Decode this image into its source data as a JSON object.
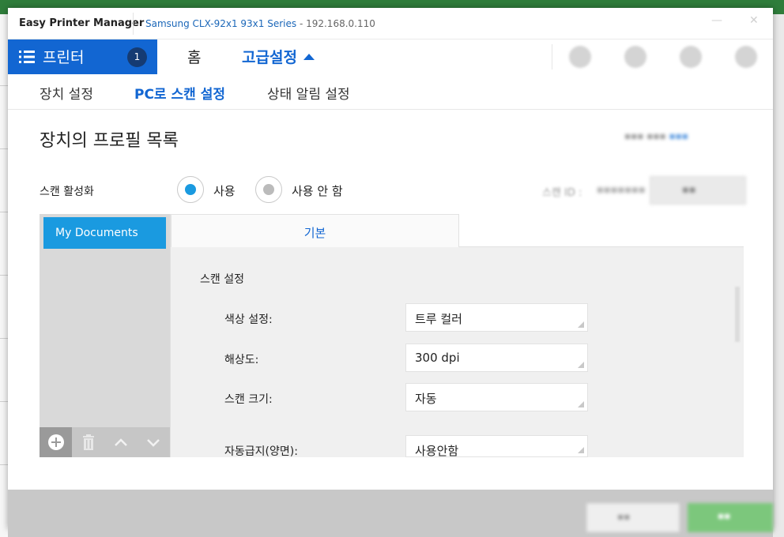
{
  "window": {
    "app_title": "Easy Printer Manager",
    "device_name": "Samsung CLX-92x1 93x1 Series",
    "device_ip": " - 192.168.0.110"
  },
  "nav": {
    "printer_label": "프린터",
    "printer_count": "1",
    "home_label": "홈",
    "advanced_label": "고급설정"
  },
  "subtabs": [
    "장치 설정",
    "PC로 스캔 설정",
    "상태 알림 설정"
  ],
  "content": {
    "heading": "장치의 프로필 목록",
    "scan_enable_label": "스캔 활성화",
    "radio_use": "사용",
    "radio_not_use": "사용 안 함",
    "scan_id_label": "스캔 ID :"
  },
  "profiles": [
    "My Documents"
  ],
  "detail": {
    "tab_basic": "기본",
    "section_title": "스캔 설정",
    "fields": [
      {
        "label": "색상 설정:",
        "value": "트루 컬러"
      },
      {
        "label": "해상도:",
        "value": "300 dpi"
      },
      {
        "label": "스캔 크기:",
        "value": "자동"
      },
      {
        "label": "자동급지(양면):",
        "value": "사용안함"
      }
    ]
  },
  "colors": {
    "accent": "#1266d2",
    "selection": "#1a9ae0",
    "ok_button": "#7cc77c"
  }
}
